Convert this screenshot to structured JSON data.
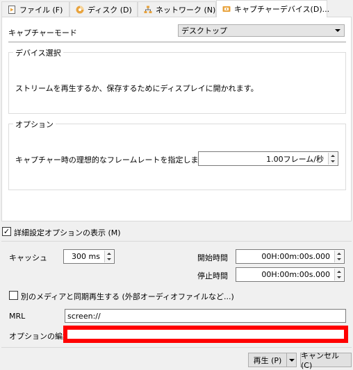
{
  "tabs": [
    {
      "label": "ファイル (F)",
      "icon": "file-play-icon"
    },
    {
      "label": "ディスク (D)",
      "icon": "disc-icon"
    },
    {
      "label": "ネットワーク (N)",
      "icon": "network-icon"
    },
    {
      "label": "キャプチャーデバイス(D)...",
      "icon": "capture-device-icon"
    }
  ],
  "capture": {
    "mode_label": "キャプチャーモード",
    "mode_value": "デスクトップ"
  },
  "device_group": {
    "title": "デバイス選択",
    "description": "ストリームを再生するか、保存するためにディスプレイに開かれます。"
  },
  "options_group": {
    "title": "オプション",
    "framerate_label": "キャプチャー時の理想的なフレームレートを指定します。",
    "framerate_value": "1.00フレーム/秒"
  },
  "advanced": {
    "show_label": "詳細設定オプションの表示 (M)",
    "show_checked": true,
    "checkmark": "✓",
    "cache_label": "キャッシュ",
    "cache_value": "300 ms",
    "start_label": "開始時間",
    "start_value": "00H:00m:00s.000",
    "stop_label": "停止時間",
    "stop_value": "00H:00m:00s.000",
    "sync_label": "別のメディアと同期再生する (外部オーディオファイルなど...)",
    "sync_checked": false,
    "mrl_label": "MRL",
    "mrl_value": "screen://",
    "edit_options_label": "オプションの編集",
    "edit_options_value": ""
  },
  "footer": {
    "play_label": "再生 (P)",
    "cancel_label": "キャンセル (C)"
  },
  "colors": {
    "highlight_red": "#ff0000",
    "icon_orange": "#e8a33d"
  }
}
